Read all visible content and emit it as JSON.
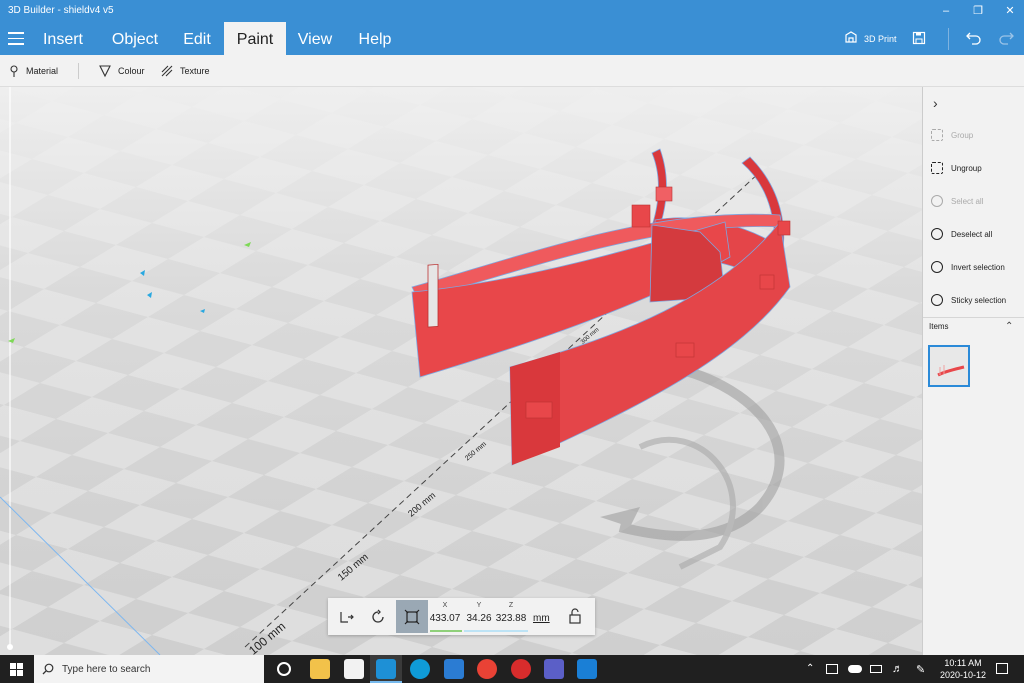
{
  "window": {
    "title": "3D Builder - shieldv4 v5",
    "controls": [
      "minimize",
      "maximize",
      "close"
    ]
  },
  "ribbon": {
    "tabs": [
      {
        "label": "Insert"
      },
      {
        "label": "Object"
      },
      {
        "label": "Edit"
      },
      {
        "label": "Paint",
        "active": true
      },
      {
        "label": "View"
      },
      {
        "label": "Help"
      }
    ],
    "print_label": "3D Print",
    "icons": [
      "print-3d-icon",
      "save-icon",
      "undo-icon",
      "redo-icon"
    ]
  },
  "toolbar": {
    "material_label": "Material",
    "colour_label": "Colour",
    "texture_label": "Texture"
  },
  "sidepanel": {
    "group": "Group",
    "ungroup": "Ungroup",
    "select_all": "Select all",
    "deselect_all": "Deselect all",
    "invert_selection": "Invert selection",
    "sticky_selection": "Sticky selection",
    "items_label": "Items"
  },
  "viewport": {
    "dims": [
      "100 mm",
      "150 mm",
      "200 mm",
      "250 mm",
      "300 mm"
    ],
    "object_color": "#e8474a"
  },
  "coords": {
    "x_label": "X",
    "y_label": "Y",
    "z_label": "Z",
    "x": "433.07",
    "y": "34.26",
    "z": "323.88",
    "unit": "mm"
  },
  "taskbar": {
    "search_placeholder": "Type here to search",
    "time": "10:11 AM",
    "date": "2020-10-12",
    "apps": [
      "task-view",
      "file-explorer",
      "store",
      "3d-builder",
      "edge",
      "files",
      "chrome",
      "app-red",
      "teams",
      "mail"
    ]
  }
}
